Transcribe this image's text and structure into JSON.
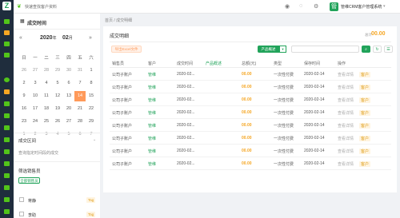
{
  "topbar": {
    "site": "快速查找客户资料",
    "user": "管维CRM客户管理系统",
    "avatar_char": "管"
  },
  "rail": {
    "logo": "Z"
  },
  "left": {
    "title": "成交时间",
    "year": "2020",
    "year_suffix": "年",
    "month": "02",
    "month_suffix": "月",
    "prev": "«",
    "next": "»",
    "weekdays": [
      "日",
      "一",
      "二",
      "三",
      "四",
      "五",
      "六"
    ],
    "weeks": [
      [
        "26",
        "27",
        "28",
        "29",
        "30",
        "31",
        "1"
      ],
      [
        "2",
        "3",
        "4",
        "5",
        "6",
        "7",
        "8"
      ],
      [
        "9",
        "10",
        "11",
        "12",
        "13",
        "14",
        "15"
      ],
      [
        "16",
        "17",
        "18",
        "19",
        "20",
        "21",
        "22"
      ],
      [
        "23",
        "24",
        "25",
        "26",
        "27",
        "28",
        "29"
      ],
      [
        "1",
        "2",
        "3",
        "4",
        "5",
        "6",
        "7"
      ]
    ],
    "selected_day": "14",
    "interval_label": "成交区间",
    "interval_placeholder": "查询指定时间段的成交",
    "filter_label": "筛选销售员",
    "all_btn": "全部销售员",
    "people": [
      {
        "name": "蒋静",
        "tag": "Tag"
      },
      {
        "name": "李助",
        "tag": "Tag"
      }
    ]
  },
  "breadcrumb": "首页 / 成交明细",
  "card": {
    "title": "成交明细",
    "total_label": "总计",
    "total": "00.00",
    "export_btn": "导出Excel文件",
    "product_btn": "产品概述",
    "product_caret": "▾",
    "columns": [
      "销售员",
      "客户",
      "成交时间",
      "产品概述",
      "总额(元)",
      "类型",
      "保存时间",
      "操作"
    ],
    "rows": [
      {
        "seller": "公司子账户",
        "customer": "管维",
        "time": "2020-02...",
        "amount": "00.00",
        "type": "一次性付费",
        "saved": "2020-02-14",
        "detail": "查看详情",
        "tag": "客户"
      },
      {
        "seller": "公司子账户",
        "customer": "管维",
        "time": "2020-02...",
        "amount": "00.00",
        "type": "一次性付费",
        "saved": "2020-02-14",
        "detail": "查看详情",
        "tag": "客户"
      },
      {
        "seller": "公司子账户",
        "customer": "管维",
        "time": "2020-02...",
        "amount": "00.00",
        "type": "一次性付费",
        "saved": "2020-02-14",
        "detail": "查看详情",
        "tag": "客户"
      },
      {
        "seller": "公司子账户",
        "customer": "管维",
        "time": "2020-02...",
        "amount": "00.00",
        "type": "一次性付费",
        "saved": "2020-02-14",
        "detail": "查看详情",
        "tag": "客户"
      },
      {
        "seller": "公司子账户",
        "customer": "管维",
        "time": "2020-02...",
        "amount": "00.00",
        "type": "一次性付费",
        "saved": "2020-02-14",
        "detail": "查看详情",
        "tag": "客户"
      },
      {
        "seller": "公司子账户",
        "customer": "管维",
        "time": "2020-02...",
        "amount": "00.00",
        "type": "一次性付费",
        "saved": "2020-02-14",
        "detail": "查看详情",
        "tag": "客户"
      },
      {
        "seller": "公司子账户",
        "customer": "管维",
        "time": "2020-02...",
        "amount": "00.00",
        "type": "一次性付费",
        "saved": "2020-02-14",
        "detail": "查看详情",
        "tag": "客户"
      },
      {
        "seller": "公司子账户",
        "customer": "管维",
        "time": "2020-02...",
        "amount": "00.00",
        "type": "一次性付费",
        "saved": "2020-02-14",
        "detail": "查看详情",
        "tag": "客户"
      }
    ]
  },
  "colors": {
    "brand": "#21a35a",
    "accent": "#ff9a5a",
    "amount": "#f5a623",
    "rail": "#1f2d3d"
  },
  "icons": [
    "leaf-icon",
    "bell-icon",
    "chat-icon",
    "settings-icon",
    "calendar-icon",
    "search-icon",
    "refresh-icon",
    "list-icon"
  ]
}
